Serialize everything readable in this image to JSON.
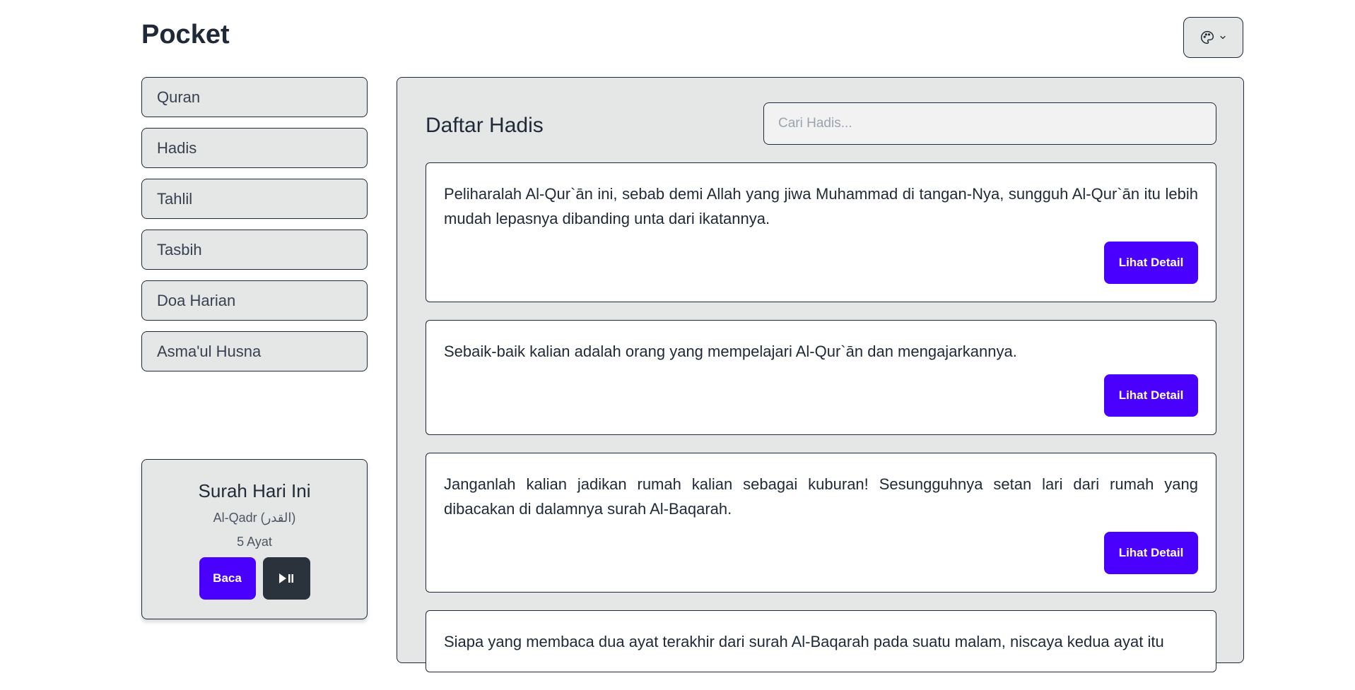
{
  "app": {
    "title": "Pocket",
    "theme_icon": "palette-icon",
    "theme_chevron_icon": "chevron-down-icon",
    "accent_color": "#4a00ff"
  },
  "sidebar": {
    "items": [
      {
        "label": "Quran"
      },
      {
        "label": "Hadis"
      },
      {
        "label": "Tahlil"
      },
      {
        "label": "Tasbih"
      },
      {
        "label": "Doa Harian"
      },
      {
        "label": "Asma'ul Husna"
      }
    ]
  },
  "surah_today": {
    "title": "Surah Hari Ini",
    "name": "Al-Qadr (القدر)",
    "ayat": "5 Ayat",
    "read_label": "Baca",
    "play_icon": "play-pause-icon"
  },
  "main": {
    "title": "Daftar Hadis",
    "search_placeholder": "Cari Hadis...",
    "detail_label": "Lihat Detail",
    "hadis": [
      {
        "text": "Peliharalah Al-Qur`ān ini, sebab demi Allah yang jiwa Muhammad di tangan-Nya, sungguh Al-Qur`ān itu lebih mudah lepasnya dibanding unta dari ikatannya."
      },
      {
        "text": "Sebaik-baik kalian adalah orang yang mempelajari Al-Qur`ān dan mengajarkannya."
      },
      {
        "text": "Janganlah kalian jadikan rumah kalian sebagai kuburan! Sesungguhnya setan lari dari rumah yang dibacakan di dalamnya surah Al-Baqarah."
      },
      {
        "text": "Siapa yang membaca dua ayat terakhir dari surah Al-Baqarah pada suatu malam, niscaya kedua ayat itu"
      }
    ]
  }
}
